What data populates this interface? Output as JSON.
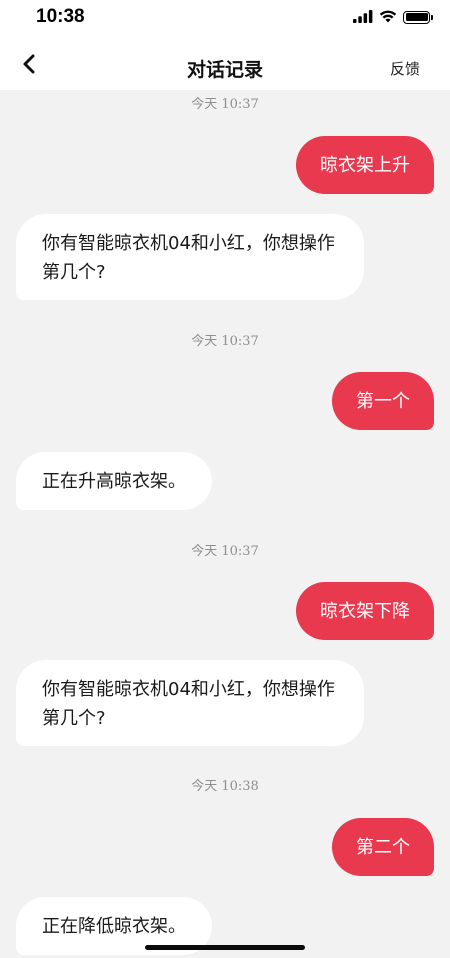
{
  "status_bar": {
    "time": "10:38"
  },
  "header": {
    "back_icon": "chevron-left-icon",
    "title": "对话记录",
    "feedback_label": "反馈"
  },
  "messages": [
    {
      "type": "timestamp",
      "text": "今天 10:37"
    },
    {
      "type": "user",
      "text": "晾衣架上升"
    },
    {
      "type": "bot",
      "text": "你有智能晾衣机04和小红，你想操作第几个?"
    },
    {
      "type": "timestamp",
      "text": "今天 10:37"
    },
    {
      "type": "user",
      "text": "第一个"
    },
    {
      "type": "bot",
      "text": "正在升高晾衣架。"
    },
    {
      "type": "timestamp",
      "text": "今天 10:37"
    },
    {
      "type": "user",
      "text": "晾衣架下降"
    },
    {
      "type": "bot",
      "text": "你有智能晾衣机04和小红，你想操作第几个?"
    },
    {
      "type": "timestamp",
      "text": "今天 10:38"
    },
    {
      "type": "user",
      "text": "第二个"
    },
    {
      "type": "bot",
      "text": "正在降低晾衣架。"
    }
  ],
  "colors": {
    "user_bubble": "#e8394f",
    "bot_bubble": "#ffffff",
    "chat_background": "#f2f2f2"
  }
}
